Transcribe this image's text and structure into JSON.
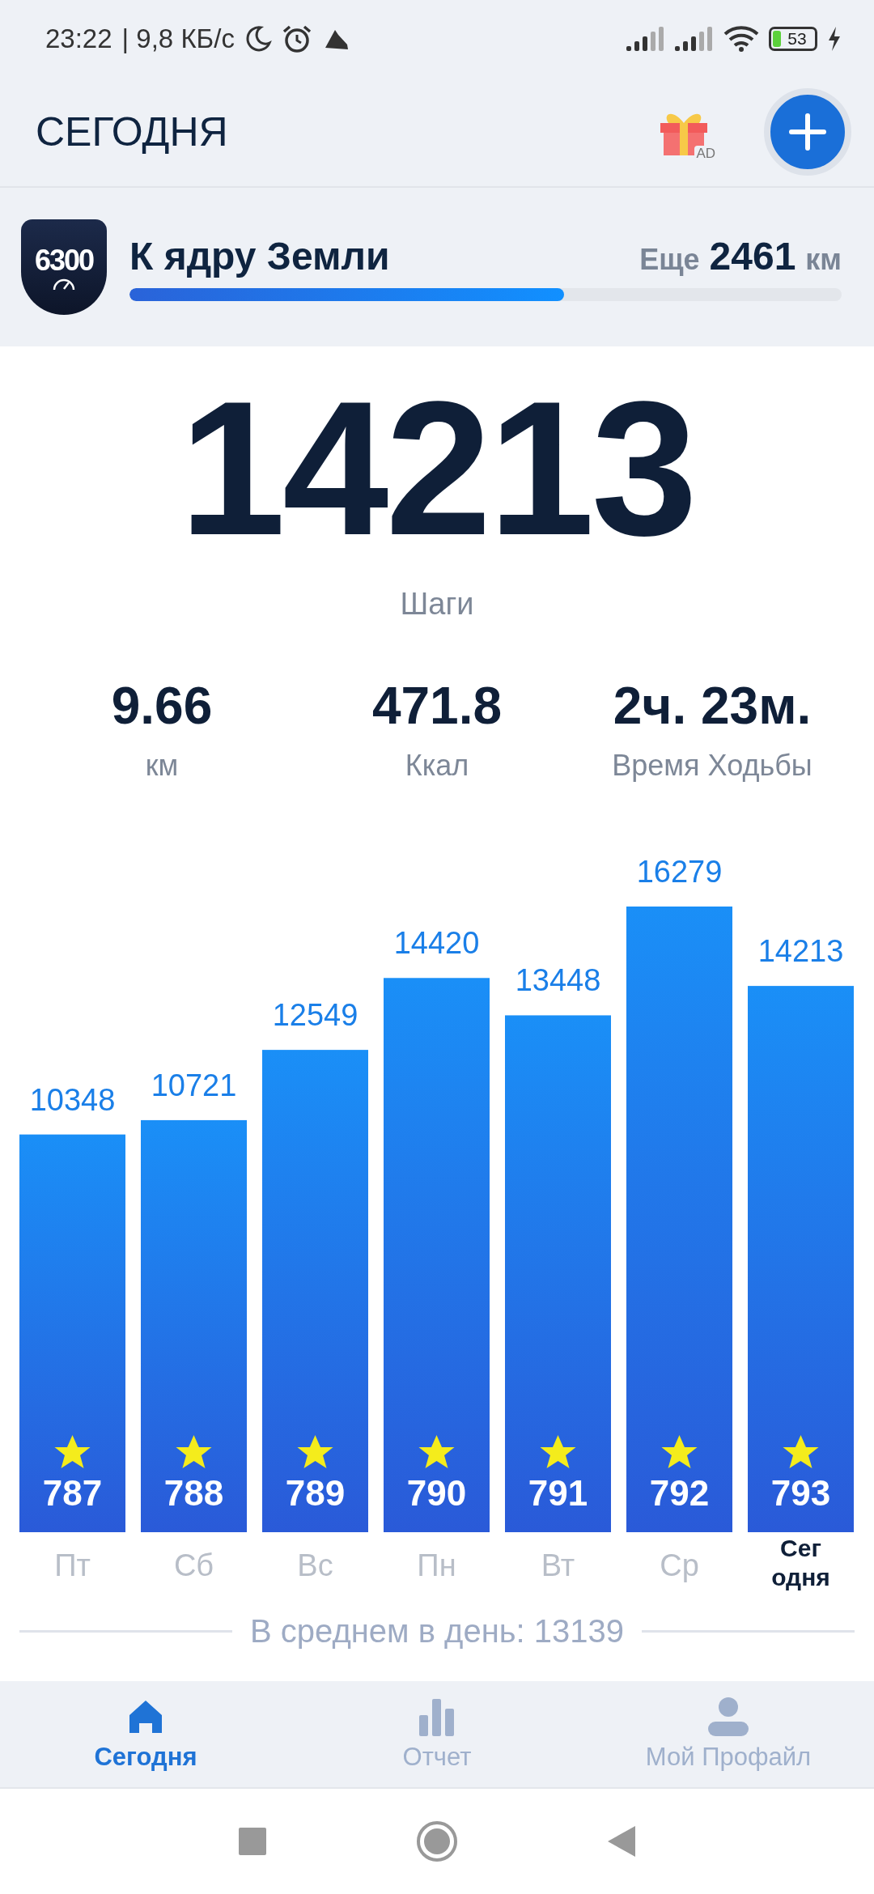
{
  "status_bar": {
    "time": "23:22",
    "network_speed": "| 9,8 КБ/с",
    "battery": "53"
  },
  "header": {
    "title": "СЕГОДНЯ",
    "gift_label": "AD"
  },
  "challenge": {
    "badge": "6300",
    "title": "К ядру Земли",
    "remaining_prefix": "Еще",
    "remaining_value": "2461",
    "remaining_unit": "км",
    "level": 0.61
  },
  "steps": {
    "value": "14213",
    "label": "Шаги"
  },
  "stats": [
    {
      "value": "9.66",
      "label": "км"
    },
    {
      "value": "471.8",
      "label": "Ккал"
    },
    {
      "value": "2ч. 23м.",
      "label": "Время Ходьбы"
    }
  ],
  "chart_data": {
    "type": "bar",
    "categories": [
      "Пт",
      "Сб",
      "Вс",
      "Пн",
      "Вт",
      "Ср",
      "Сегодня"
    ],
    "values": [
      10348,
      10721,
      12549,
      14420,
      13448,
      16279,
      14213
    ],
    "value_labels": [
      "10348",
      "10721",
      "12549",
      "14420",
      "13448",
      "16279",
      "14213"
    ]
  },
  "bars": [
    {
      "badge": "787",
      "selected": false
    },
    {
      "badge": "788",
      "selected": false
    },
    {
      "badge": "789",
      "selected": false
    },
    {
      "badge": "790",
      "selected": false
    },
    {
      "badge": "791",
      "selected": false
    },
    {
      "badge": "792",
      "selected": false
    },
    {
      "badge": "793",
      "selected": true
    }
  ],
  "average": "В среднем в день: 13139",
  "bottom_nav": [
    {
      "label": "Сегодня",
      "selected": true
    },
    {
      "label": "Отчет",
      "selected": false
    },
    {
      "label": "Мой Профайл",
      "selected": false
    }
  ]
}
